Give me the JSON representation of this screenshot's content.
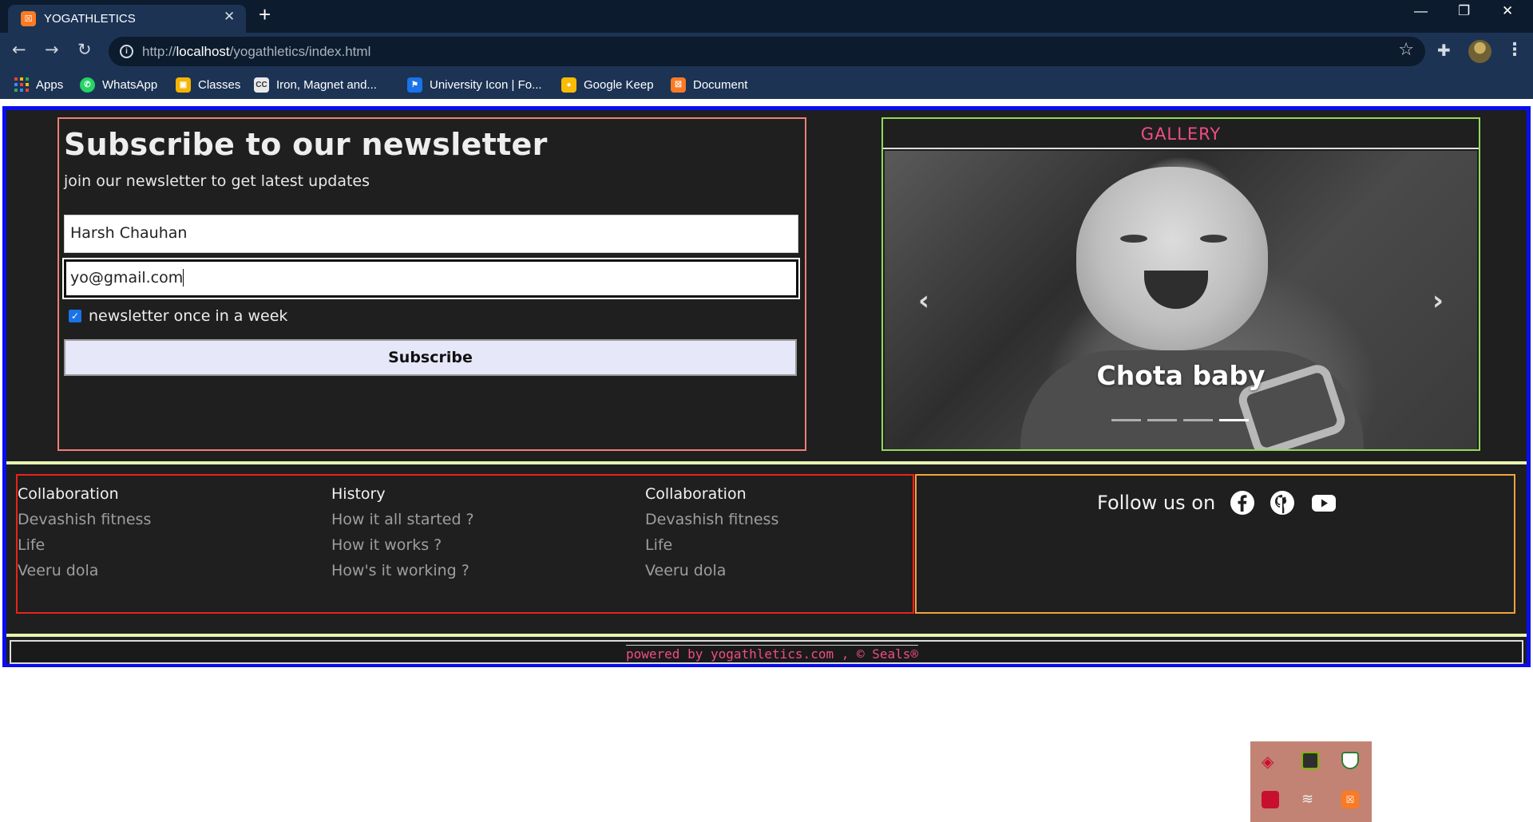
{
  "browser": {
    "tab": {
      "title": "YOGATHLETICS",
      "favicon": "xampp-icon"
    },
    "new_tab_label": "+",
    "address": {
      "prefix": "http://",
      "host": "localhost",
      "path": "/yogathletics/index.html"
    },
    "bookmarks": [
      {
        "label": "Apps",
        "icon": "apps-grid-icon"
      },
      {
        "label": "WhatsApp",
        "icon": "whatsapp-icon"
      },
      {
        "label": "Classes",
        "icon": "classroom-icon"
      },
      {
        "label": "Iron, Magnet and...",
        "icon": "cc-icon"
      },
      {
        "label": "University Icon | Fo...",
        "icon": "flag-icon"
      },
      {
        "label": "Google Keep",
        "icon": "keep-icon"
      },
      {
        "label": "Document",
        "icon": "xampp-icon"
      }
    ]
  },
  "newsletter": {
    "title": "Subscribe to our newsletter",
    "subtitle": "join our newsletter to get latest updates",
    "name_value": "Harsh Chauhan",
    "email_value": "yo@gmail.com",
    "checkbox_label": "newsletter once in a week",
    "checkbox_checked": true,
    "button_label": "Subscribe"
  },
  "gallery": {
    "title": "GALLERY",
    "caption": "Chota baby",
    "slide_count": 4,
    "active_slide": 4
  },
  "footer": {
    "columns": [
      {
        "heading": "Collaboration",
        "links": [
          "Devashish fitness",
          "Life",
          "Veeru dola"
        ]
      },
      {
        "heading": "History",
        "links": [
          "How it all started ?",
          "How it works ?",
          "How's it working ?"
        ]
      },
      {
        "heading": "Collaboration",
        "links": [
          "Devashish fitness",
          "Life",
          "Veeru dola"
        ]
      }
    ],
    "follow_label": "Follow us on",
    "social": [
      "facebook-icon",
      "github-icon",
      "youtube-icon"
    ],
    "powered": "powered by yogathletics.com , © Seals®"
  },
  "colors": {
    "chrome_dark": "#0d1b2e",
    "chrome": "#1c3354",
    "site_border": "#0a0ded",
    "site_bg": "#1f1f1f",
    "accent_pink": "#f04e82"
  }
}
